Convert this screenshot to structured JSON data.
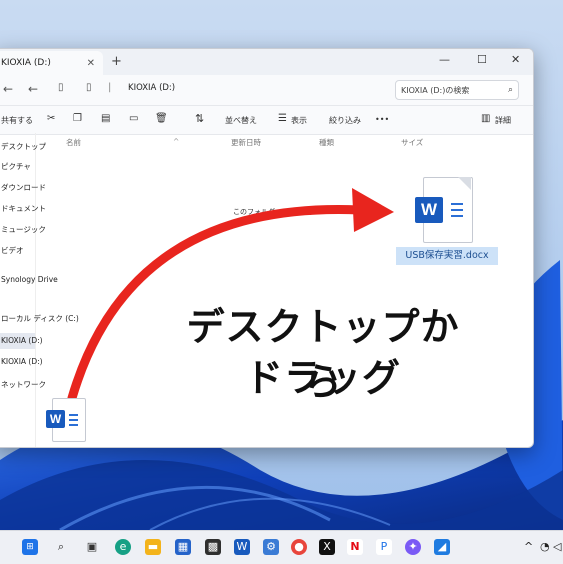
{
  "window": {
    "tab_title": "KIOXIA (D:)",
    "new_tab": "+",
    "minimize": "—",
    "maximize": "☐",
    "close": "✕"
  },
  "address": {
    "path": "KIOXIA (D:)",
    "search_placeholder": "KIOXIA (D:)の検索"
  },
  "commands": {
    "share": "共有する",
    "sort": "並べ替え",
    "view": "表示",
    "filter": "絞り込み",
    "more": "•••",
    "details": "詳細"
  },
  "sidebar": {
    "items": [
      {
        "label": "デスクトップ"
      },
      {
        "label": "ピクチャ"
      },
      {
        "label": "ダウンロード"
      },
      {
        "label": "ドキュメント"
      },
      {
        "label": "ミュージック"
      },
      {
        "label": "ビデオ"
      },
      {
        "label": "Synology Drive"
      },
      {
        "label": "ローカル ディスク (C:)"
      },
      {
        "label": "KIOXIA (D:)"
      },
      {
        "label": "KIOXIA (D:)"
      },
      {
        "label": "ネットワーク"
      }
    ]
  },
  "columns": [
    "名前",
    "更新日時",
    "種類",
    "サイズ"
  ],
  "empty_message": "このフォルダーは空です。",
  "file": {
    "name": "USB保存実習.docx",
    "icon": "word-document-icon",
    "badge": "W"
  },
  "headline": {
    "line1": "デスクトップから",
    "line2": "ドラッグ"
  },
  "colors": {
    "arrow": "#e8251e",
    "word_blue": "#185abd",
    "selection": "#cde2f8"
  },
  "taskbar": {
    "icons": [
      "windows-start-icon",
      "search-icon",
      "task-view-icon",
      "edge-icon",
      "file-explorer-icon",
      "store-icon",
      "photos-icon",
      "word-icon",
      "settings-icon",
      "chrome-icon",
      "x-icon",
      "netflix-icon",
      "teams-icon",
      "copilot-icon",
      "app-icon"
    ]
  }
}
